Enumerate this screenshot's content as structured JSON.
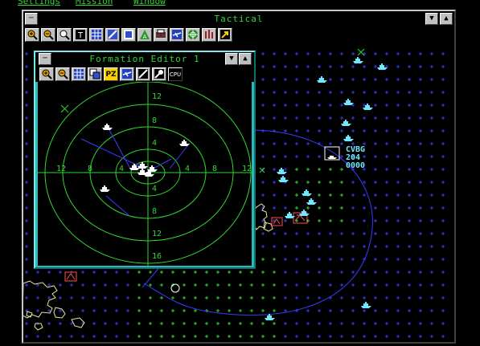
{
  "menu": {
    "items": [
      "Settings",
      "Mission",
      "Window"
    ]
  },
  "tactical": {
    "title": "Tactical",
    "toolbar_icons": [
      "zoom-in-icon",
      "zoom-out-icon",
      "search-icon",
      "text-tool-icon",
      "grid-icon",
      "wind-icon",
      "formation-icon",
      "scale-icon",
      "print-icon",
      "aircraft-icon",
      "target-icon",
      "bars-icon",
      "arrow-icon"
    ],
    "unit_label": {
      "name": "CVBG",
      "id": "204",
      "code": "0000"
    }
  },
  "formation_editor": {
    "title": "Formation Editor 1",
    "toolbar_labels": [
      "+",
      "-",
      "",
      "",
      "PZ",
      "",
      "",
      "",
      "CPU"
    ],
    "toolbar_icons": [
      "zoom-in-icon",
      "zoom-out-icon",
      "grid-icon",
      "copy-icon",
      "pz-icon",
      "aircraft-icon",
      "wind-icon",
      "probe-icon",
      "cpu-icon"
    ],
    "ring_labels": {
      "north": [
        "12",
        "8",
        "4"
      ],
      "south": [
        "4",
        "8",
        "12",
        "16"
      ],
      "west": [
        "12",
        "8",
        "4"
      ],
      "east": [
        "4",
        "8",
        "12"
      ]
    }
  },
  "colors": {
    "green": "#2fd92f",
    "blue": "#3a3aff",
    "cyan": "#6fe8ff",
    "red": "#ff5050",
    "window_gray": "#8c8c8c",
    "fe_teal": "#2ab8b8"
  }
}
